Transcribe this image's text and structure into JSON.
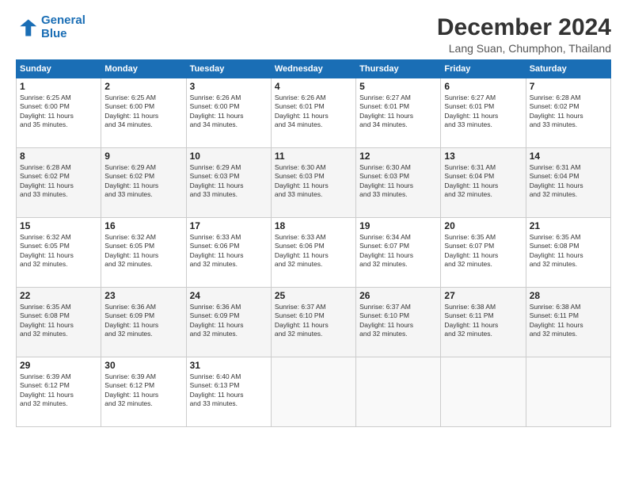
{
  "logo": {
    "line1": "General",
    "line2": "Blue"
  },
  "title": "December 2024",
  "subtitle": "Lang Suan, Chumphon, Thailand",
  "days_of_week": [
    "Sunday",
    "Monday",
    "Tuesday",
    "Wednesday",
    "Thursday",
    "Friday",
    "Saturday"
  ],
  "weeks": [
    [
      {
        "day": "1",
        "info": "Sunrise: 6:25 AM\nSunset: 6:00 PM\nDaylight: 11 hours\nand 35 minutes."
      },
      {
        "day": "2",
        "info": "Sunrise: 6:25 AM\nSunset: 6:00 PM\nDaylight: 11 hours\nand 34 minutes."
      },
      {
        "day": "3",
        "info": "Sunrise: 6:26 AM\nSunset: 6:00 PM\nDaylight: 11 hours\nand 34 minutes."
      },
      {
        "day": "4",
        "info": "Sunrise: 6:26 AM\nSunset: 6:01 PM\nDaylight: 11 hours\nand 34 minutes."
      },
      {
        "day": "5",
        "info": "Sunrise: 6:27 AM\nSunset: 6:01 PM\nDaylight: 11 hours\nand 34 minutes."
      },
      {
        "day": "6",
        "info": "Sunrise: 6:27 AM\nSunset: 6:01 PM\nDaylight: 11 hours\nand 33 minutes."
      },
      {
        "day": "7",
        "info": "Sunrise: 6:28 AM\nSunset: 6:02 PM\nDaylight: 11 hours\nand 33 minutes."
      }
    ],
    [
      {
        "day": "8",
        "info": "Sunrise: 6:28 AM\nSunset: 6:02 PM\nDaylight: 11 hours\nand 33 minutes."
      },
      {
        "day": "9",
        "info": "Sunrise: 6:29 AM\nSunset: 6:02 PM\nDaylight: 11 hours\nand 33 minutes."
      },
      {
        "day": "10",
        "info": "Sunrise: 6:29 AM\nSunset: 6:03 PM\nDaylight: 11 hours\nand 33 minutes."
      },
      {
        "day": "11",
        "info": "Sunrise: 6:30 AM\nSunset: 6:03 PM\nDaylight: 11 hours\nand 33 minutes."
      },
      {
        "day": "12",
        "info": "Sunrise: 6:30 AM\nSunset: 6:03 PM\nDaylight: 11 hours\nand 33 minutes."
      },
      {
        "day": "13",
        "info": "Sunrise: 6:31 AM\nSunset: 6:04 PM\nDaylight: 11 hours\nand 32 minutes."
      },
      {
        "day": "14",
        "info": "Sunrise: 6:31 AM\nSunset: 6:04 PM\nDaylight: 11 hours\nand 32 minutes."
      }
    ],
    [
      {
        "day": "15",
        "info": "Sunrise: 6:32 AM\nSunset: 6:05 PM\nDaylight: 11 hours\nand 32 minutes."
      },
      {
        "day": "16",
        "info": "Sunrise: 6:32 AM\nSunset: 6:05 PM\nDaylight: 11 hours\nand 32 minutes."
      },
      {
        "day": "17",
        "info": "Sunrise: 6:33 AM\nSunset: 6:06 PM\nDaylight: 11 hours\nand 32 minutes."
      },
      {
        "day": "18",
        "info": "Sunrise: 6:33 AM\nSunset: 6:06 PM\nDaylight: 11 hours\nand 32 minutes."
      },
      {
        "day": "19",
        "info": "Sunrise: 6:34 AM\nSunset: 6:07 PM\nDaylight: 11 hours\nand 32 minutes."
      },
      {
        "day": "20",
        "info": "Sunrise: 6:35 AM\nSunset: 6:07 PM\nDaylight: 11 hours\nand 32 minutes."
      },
      {
        "day": "21",
        "info": "Sunrise: 6:35 AM\nSunset: 6:08 PM\nDaylight: 11 hours\nand 32 minutes."
      }
    ],
    [
      {
        "day": "22",
        "info": "Sunrise: 6:35 AM\nSunset: 6:08 PM\nDaylight: 11 hours\nand 32 minutes."
      },
      {
        "day": "23",
        "info": "Sunrise: 6:36 AM\nSunset: 6:09 PM\nDaylight: 11 hours\nand 32 minutes."
      },
      {
        "day": "24",
        "info": "Sunrise: 6:36 AM\nSunset: 6:09 PM\nDaylight: 11 hours\nand 32 minutes."
      },
      {
        "day": "25",
        "info": "Sunrise: 6:37 AM\nSunset: 6:10 PM\nDaylight: 11 hours\nand 32 minutes."
      },
      {
        "day": "26",
        "info": "Sunrise: 6:37 AM\nSunset: 6:10 PM\nDaylight: 11 hours\nand 32 minutes."
      },
      {
        "day": "27",
        "info": "Sunrise: 6:38 AM\nSunset: 6:11 PM\nDaylight: 11 hours\nand 32 minutes."
      },
      {
        "day": "28",
        "info": "Sunrise: 6:38 AM\nSunset: 6:11 PM\nDaylight: 11 hours\nand 32 minutes."
      }
    ],
    [
      {
        "day": "29",
        "info": "Sunrise: 6:39 AM\nSunset: 6:12 PM\nDaylight: 11 hours\nand 32 minutes."
      },
      {
        "day": "30",
        "info": "Sunrise: 6:39 AM\nSunset: 6:12 PM\nDaylight: 11 hours\nand 32 minutes."
      },
      {
        "day": "31",
        "info": "Sunrise: 6:40 AM\nSunset: 6:13 PM\nDaylight: 11 hours\nand 33 minutes."
      },
      {
        "day": "",
        "info": ""
      },
      {
        "day": "",
        "info": ""
      },
      {
        "day": "",
        "info": ""
      },
      {
        "day": "",
        "info": ""
      }
    ]
  ]
}
